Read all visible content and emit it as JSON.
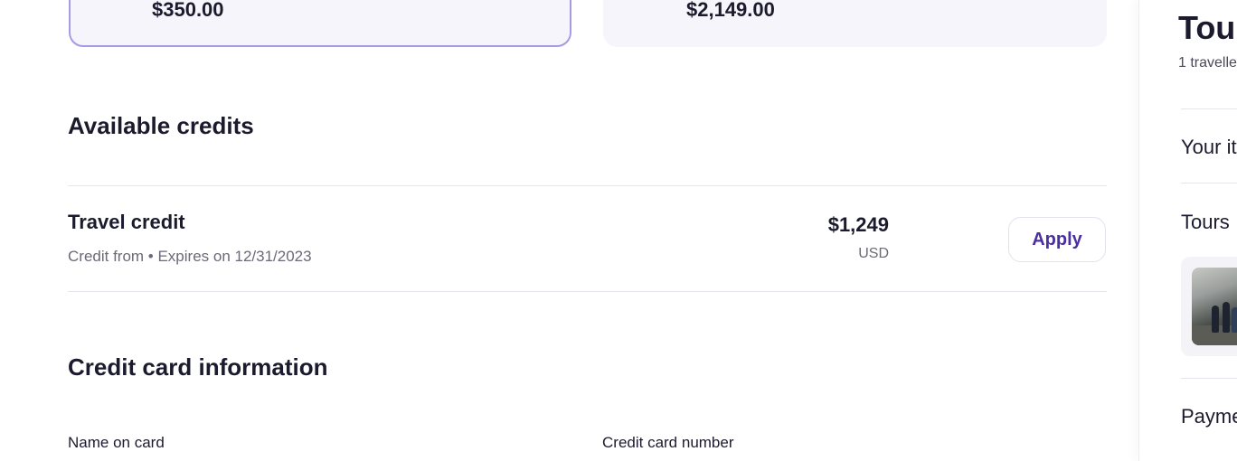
{
  "options": {
    "selected_price": "$350.00",
    "other_price": "$2,149.00"
  },
  "available_credits": {
    "title": "Available credits",
    "credit": {
      "name": "Travel credit",
      "subtitle": "Credit from • Expires on 12/31/2023",
      "amount": "$1,249",
      "currency": "USD",
      "apply_label": "Apply"
    }
  },
  "credit_card": {
    "title": "Credit card information",
    "name_label": "Name on card",
    "number_label": "Credit card number"
  },
  "sidebar": {
    "title": "Tour",
    "subtitle": "1 travelle",
    "items": [
      "Your it",
      "Tours",
      "Payme"
    ]
  },
  "colors": {
    "accent": "#4b2fa0",
    "selected_border": "#a79be6",
    "card_bg": "#f6f5fb"
  }
}
